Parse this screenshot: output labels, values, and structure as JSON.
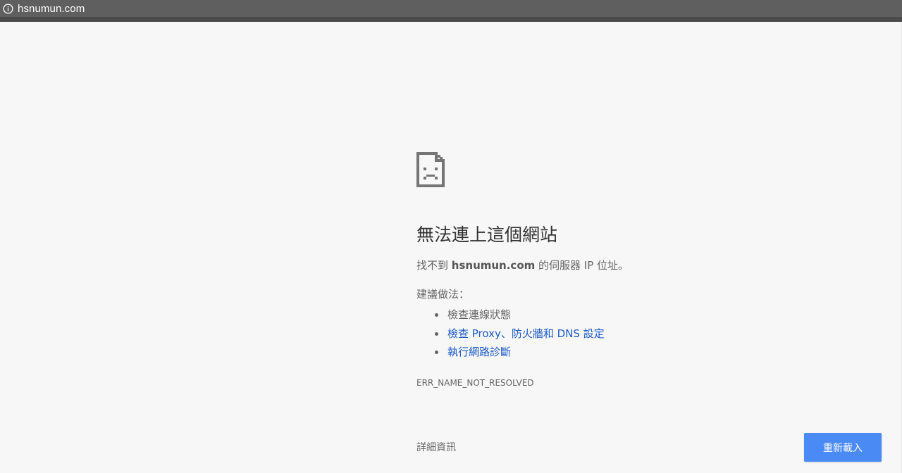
{
  "browser": {
    "url": "hsnumun.com",
    "info_icon": "info-icon"
  },
  "error_page": {
    "icon": "sad-page-icon",
    "title": "無法連上這個網站",
    "description_prefix": "找不到 ",
    "description_host": "hsnumun.com",
    "description_suffix": " 的伺服器 IP 位址。",
    "suggestions_heading": "建議做法：",
    "suggestions": [
      {
        "label": "檢查連線狀態",
        "is_link": false
      },
      {
        "label": "檢查 Proxy、防火牆和 DNS 設定",
        "is_link": true
      },
      {
        "label": "執行網路診斷",
        "is_link": true
      }
    ],
    "error_code": "ERR_NAME_NOT_RESOLVED",
    "details_label": "詳細資訊",
    "reload_label": "重新載入"
  },
  "colors": {
    "background": "#f7f7f7",
    "title": "#333333",
    "body_text": "#646464",
    "link": "#1a5ac8",
    "reload_button": "#4a8af4",
    "topbar": "#5f5f5f"
  }
}
